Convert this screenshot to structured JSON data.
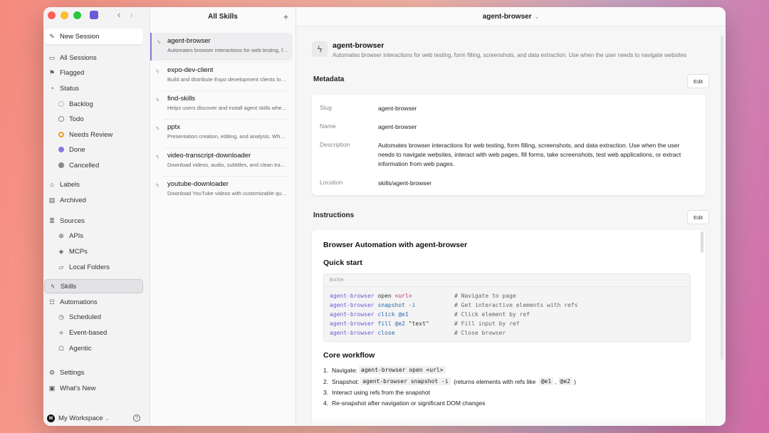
{
  "sidebar": {
    "new_session": "New Session",
    "items": [
      {
        "label": "All Sessions",
        "icon": "inbox-icon"
      },
      {
        "label": "Flagged",
        "icon": "flag-icon"
      },
      {
        "label": "Status",
        "icon": "status-icon"
      },
      {
        "label": "Backlog",
        "icon": "backlog-icon"
      },
      {
        "label": "Todo",
        "icon": "todo-icon"
      },
      {
        "label": "Needs Review",
        "icon": "review-icon"
      },
      {
        "label": "Done",
        "icon": "done-icon"
      },
      {
        "label": "Cancelled",
        "icon": "cancelled-icon"
      },
      {
        "label": "Labels",
        "icon": "tag-icon"
      },
      {
        "label": "Archived",
        "icon": "archive-icon"
      },
      {
        "label": "Sources",
        "icon": "database-icon"
      },
      {
        "label": "APIs",
        "icon": "globe-icon"
      },
      {
        "label": "MCPs",
        "icon": "mcp-icon"
      },
      {
        "label": "Local Folders",
        "icon": "folder-icon"
      },
      {
        "label": "Skills",
        "icon": "bolt-icon"
      },
      {
        "label": "Automations",
        "icon": "automations-icon"
      },
      {
        "label": "Scheduled",
        "icon": "clock-icon"
      },
      {
        "label": "Event-based",
        "icon": "event-icon"
      },
      {
        "label": "Agentic",
        "icon": "robot-icon"
      },
      {
        "label": "Settings",
        "icon": "gear-icon"
      },
      {
        "label": "What's New",
        "icon": "gift-icon"
      }
    ],
    "workspace": "My Workspace",
    "workspace_initial": "M"
  },
  "skills_list": {
    "title": "All Skills",
    "items": [
      {
        "name": "agent-browser",
        "desc": "Automates browser interactions for web testing, form filling"
      },
      {
        "name": "expo-dev-client",
        "desc": "Build and distribute Expo development clients locally"
      },
      {
        "name": "find-skills",
        "desc": "Helps users discover and install agent skills when they"
      },
      {
        "name": "pptx",
        "desc": "Presentation creation, editing, and analysis. When Claude"
      },
      {
        "name": "video-transcript-downloader",
        "desc": "Download videos, audio, subtitles, and clean transcripts"
      },
      {
        "name": "youtube-downloader",
        "desc": "Download YouTube videos with customizable quality"
      }
    ]
  },
  "main": {
    "header": "agent-browser",
    "skill_name": "agent-browser",
    "skill_desc": "Automates browser interactions for web testing, form filling, screenshots, and data extraction. Use when the user needs to navigate websites",
    "metadata_title": "Metadata",
    "instructions_title": "Instructions",
    "edit_label": "Edit",
    "metadata": [
      {
        "key": "Slug",
        "value": "agent-browser"
      },
      {
        "key": "Name",
        "value": "agent-browser"
      },
      {
        "key": "Description",
        "value": "Automates browser interactions for web testing, form filling, screenshots, and data extraction. Use when the user needs to navigate websites, interact with web pages, fill forms, take screenshots, test web applications, or extract information from web pages."
      },
      {
        "key": "Location",
        "value": "skills/agent-browser"
      }
    ],
    "instructions": {
      "h1": "Browser Automation with agent-browser",
      "quick_start": "Quick start",
      "code_lang": "BASH",
      "code": [
        {
          "cmd": "agent-browser",
          "arg": " open ",
          "rest": "<url>",
          "comment": "# Navigate to page"
        },
        {
          "cmd": "agent-browser",
          "arg": " snapshot -i",
          "rest": "",
          "comment": "# Get interactive elements with refs"
        },
        {
          "cmd": "agent-browser",
          "arg": " click @e1",
          "rest": "",
          "comment": "# Click element by ref"
        },
        {
          "cmd": "agent-browser",
          "arg": " fill @e2 ",
          "rest": "\"text\"",
          "comment": "# Fill input by ref"
        },
        {
          "cmd": "agent-browser",
          "arg": " close",
          "rest": "",
          "comment": "# Close browser"
        }
      ],
      "core_workflow": "Core workflow",
      "steps": [
        {
          "n": "1.",
          "pre": "Navigate: ",
          "code": "agent-browser open <url>",
          "post": ""
        },
        {
          "n": "2.",
          "pre": "Snapshot: ",
          "code": "agent-browser snapshot -i",
          "post": " (returns elements with refs like "
        },
        {
          "n": "3.",
          "pre": "Interact using refs from the snapshot",
          "code": "",
          "post": ""
        },
        {
          "n": "4.",
          "pre": "Re-snapshot after navigation or significant DOM changes",
          "code": "",
          "post": ""
        }
      ],
      "ref1": "@e1",
      "ref2": "@e2",
      "ref_close": ")"
    }
  },
  "colors": {
    "accent": "#6b5bd6",
    "needs_review": "#f0a020",
    "done": "#8a7ae0"
  }
}
